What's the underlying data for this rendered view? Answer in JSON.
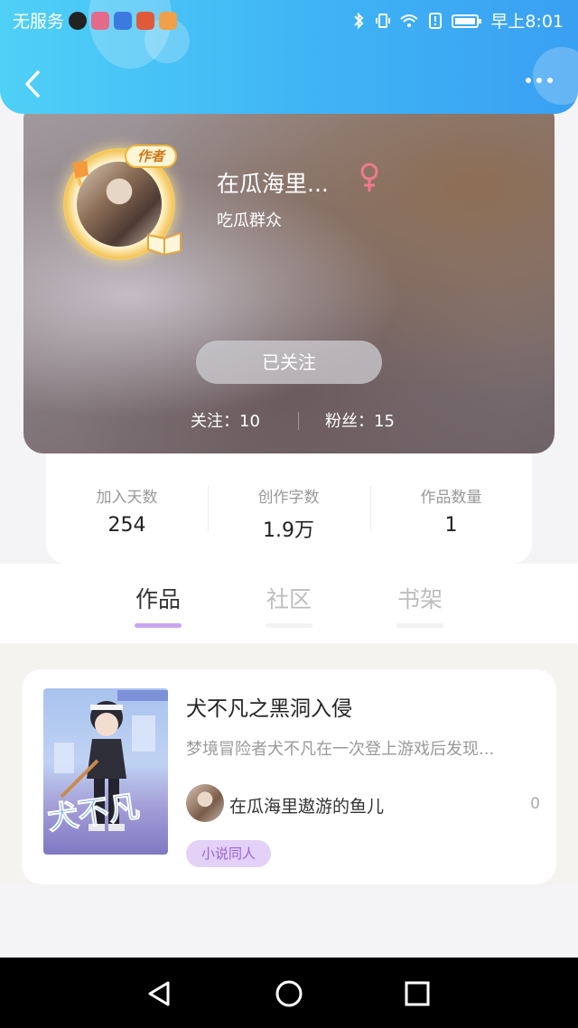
{
  "status_bar": {
    "carrier": "无服务",
    "time": "早上8:01",
    "icons": [
      "tiktok-icon",
      "app-icon",
      "baidu-icon",
      "news-icon",
      "video-icon",
      "bluetooth-icon",
      "vibrate-icon",
      "wifi-icon",
      "alert-icon",
      "battery-icon"
    ]
  },
  "header": {
    "back_icon": "chevron-left-icon",
    "more_icon": "more-dots-icon"
  },
  "profile": {
    "author_tag": "作者",
    "name": "在瓜海里...",
    "gender_symbol": "♀",
    "subtitle": "吃瓜群众",
    "follow_button": "已关注",
    "following_label": "关注：10",
    "fans_label": "粉丝：15"
  },
  "stats": [
    {
      "label": "加入天数",
      "value": "254"
    },
    {
      "label": "创作字数",
      "value": "1.9万"
    },
    {
      "label": "作品数量",
      "value": "1"
    }
  ],
  "tabs": [
    {
      "label": "作品",
      "active": true
    },
    {
      "label": "社区",
      "active": false
    },
    {
      "label": "书架",
      "active": false
    }
  ],
  "work": {
    "title": "犬不凡之黑洞入侵",
    "description": "梦境冒险者犬不凡在一次登上游戏后发现...",
    "author": "在瓜海里遨游的鱼儿",
    "count": "0",
    "tag": "小说同人",
    "cover_text": "犬不凡"
  },
  "nav": {
    "back_icon": "triangle-back-icon",
    "home_icon": "circle-home-icon",
    "recents_icon": "square-recents-icon"
  },
  "colors": {
    "header_gradient_start": "#4fd0f6",
    "header_gradient_end": "#3aa0f2",
    "tab_active_underline": "#c9a6f0",
    "tag_background": "#e3d1f7",
    "tag_text": "#9b63d8",
    "gender_color": "#f07a8c"
  }
}
